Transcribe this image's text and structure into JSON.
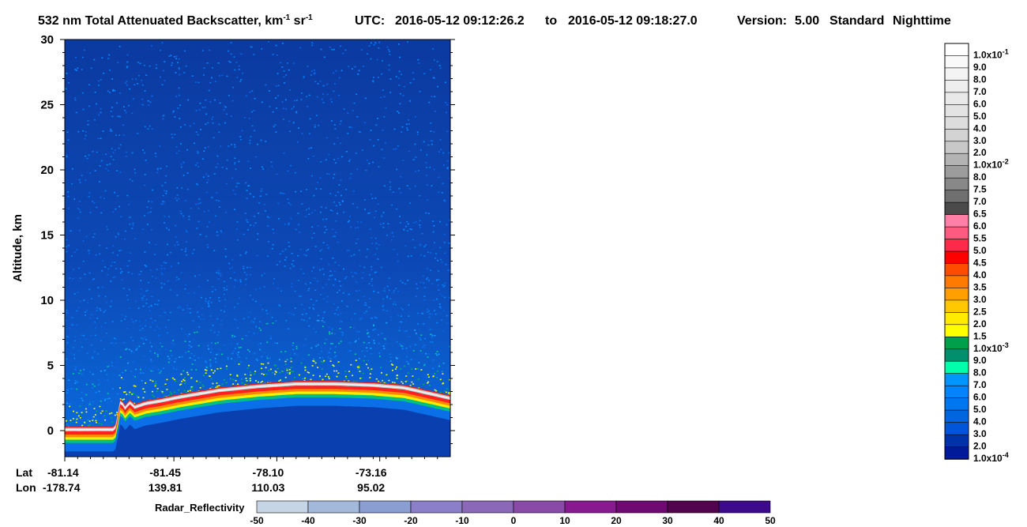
{
  "header": {
    "title_main": "532 nm Total Attenuated Backscatter, km",
    "title_exp1": "-1",
    "title_sr": " sr",
    "title_exp2": "-1",
    "utc_label": "UTC:",
    "utc_start": "2016-05-12 09:12:26.2",
    "utc_to": "to",
    "utc_end": "2016-05-12 09:18:27.0",
    "version_label": "Version:",
    "version": "5.00",
    "product": "Standard",
    "mode": "Nighttime"
  },
  "chart_data": {
    "type": "heatmap",
    "title": "532 nm Total Attenuated Backscatter, km-1 sr-1",
    "ylabel": "Altitude, km",
    "ylim": [
      -2,
      30
    ],
    "yticks": [
      "0",
      "5",
      "10",
      "15",
      "20",
      "25",
      "30"
    ],
    "ytick_values": [
      0,
      5,
      10,
      15,
      20,
      25,
      30
    ],
    "x_axis": {
      "lat_label": "Lat",
      "lon_label": "Lon",
      "ticks": [
        {
          "lat": "-81.14",
          "lon": "-178.74",
          "frac": 0.0
        },
        {
          "lat": "-81.45",
          "lon": "139.81",
          "frac": 0.283
        },
        {
          "lat": "-78.10",
          "lon": "110.03",
          "frac": 0.55
        },
        {
          "lat": "-73.16",
          "lon": "95.02",
          "frac": 0.817
        }
      ]
    },
    "surface_profile": {
      "frac": [
        0.0,
        0.13,
        0.14,
        0.145,
        0.155,
        0.17,
        0.18,
        0.21,
        0.25,
        0.3,
        0.4,
        0.5,
        0.6,
        0.7,
        0.8,
        0.88,
        0.94,
        1.0
      ],
      "altitude_km": [
        0.0,
        0.0,
        1.4,
        2.3,
        1.6,
        2.1,
        1.7,
        2.0,
        2.2,
        2.5,
        3.0,
        3.3,
        3.5,
        3.5,
        3.4,
        3.2,
        2.8,
        2.4
      ]
    },
    "colorbar": {
      "entries": [
        {
          "label": "1.0x10",
          "exp": "-1",
          "color": "#ffffff"
        },
        {
          "label": "9.0",
          "color": "#f9f9f9"
        },
        {
          "label": "8.0",
          "color": "#f4f4f4"
        },
        {
          "label": "7.0",
          "color": "#eeeeee"
        },
        {
          "label": "6.0",
          "color": "#e9e9e9"
        },
        {
          "label": "5.0",
          "color": "#e3e3e3"
        },
        {
          "label": "4.0",
          "color": "#dddddd"
        },
        {
          "label": "3.0",
          "color": "#d3d3d3"
        },
        {
          "label": "2.0",
          "color": "#c8c8c8"
        },
        {
          "label": "1.0x10",
          "exp": "-2",
          "color": "#b3b3b3"
        },
        {
          "label": "8.0",
          "color": "#9c9c9c"
        },
        {
          "label": "7.5",
          "color": "#888888"
        },
        {
          "label": "7.0",
          "color": "#707070"
        },
        {
          "label": "6.5",
          "color": "#4a4a4a"
        },
        {
          "label": "6.0",
          "color": "#ff7fa6"
        },
        {
          "label": "5.5",
          "color": "#ff5a80"
        },
        {
          "label": "5.0",
          "color": "#ff2a4a"
        },
        {
          "label": "4.5",
          "color": "#ff0000"
        },
        {
          "label": "4.0",
          "color": "#ff4d00"
        },
        {
          "label": "3.5",
          "color": "#ff7a00"
        },
        {
          "label": "3.0",
          "color": "#ffa000"
        },
        {
          "label": "2.5",
          "color": "#ffc800"
        },
        {
          "label": "2.0",
          "color": "#ffeb00"
        },
        {
          "label": "1.5",
          "color": "#ffff00"
        },
        {
          "label": "1.0x10",
          "exp": "-3",
          "color": "#00a04a"
        },
        {
          "label": "9.0",
          "color": "#00906e"
        },
        {
          "label": "8.0",
          "color": "#00ffaa"
        },
        {
          "label": "7.0",
          "color": "#0096ff"
        },
        {
          "label": "6.0",
          "color": "#0084ff"
        },
        {
          "label": "5.0",
          "color": "#0076f0"
        },
        {
          "label": "4.0",
          "color": "#0066e0"
        },
        {
          "label": "3.0",
          "color": "#0055d8"
        },
        {
          "label": "2.0",
          "color": "#0033aa"
        },
        {
          "label": "1.0x10",
          "exp": "-4",
          "color": "#001a99"
        }
      ]
    },
    "radar_bar": {
      "label": "Radar_Reflectivity",
      "ticks": [
        "-50",
        "-40",
        "-30",
        "-20",
        "-10",
        "0",
        "10",
        "20",
        "30",
        "40",
        "50"
      ],
      "colors": [
        "#c5d5e6",
        "#a3b9dc",
        "#8a9ed2",
        "#8a7fc8",
        "#8b68b8",
        "#8a4aa8",
        "#861a8e",
        "#6e0a72",
        "#52044e",
        "#3c0a8a"
      ]
    }
  }
}
